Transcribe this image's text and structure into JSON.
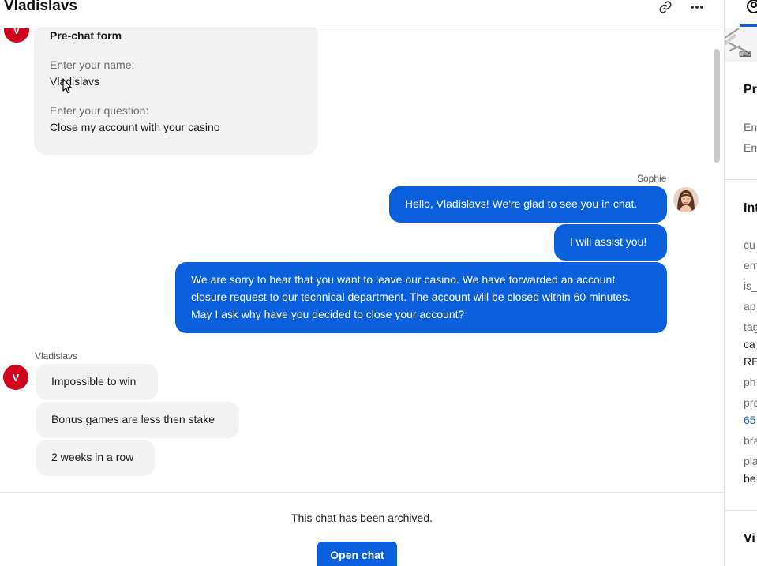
{
  "header": {
    "title": "Vladislavs"
  },
  "prechat": {
    "avatar_letter": "V",
    "title": "Pre-chat form",
    "fields": [
      {
        "label": "Enter your name:",
        "value": "Vladislavs"
      },
      {
        "label": "Enter your question:",
        "value": "Close my account with your casino"
      }
    ]
  },
  "agent": {
    "name": "Sophie",
    "messages": [
      "Hello, Vladislavs! We're glad to see you in chat.",
      "I will assist you!",
      "We are sorry to hear that you want to leave our casino. We have forwarded an account closure request to our technical department. The account will be closed within 60 minutes. May I ask why have you decided to close your account?"
    ]
  },
  "customer": {
    "name": "Vladislavs",
    "avatar_letter": "V",
    "messages": [
      "Impossible to win",
      "Bonus games are less then stake",
      "2 weeks in a row"
    ]
  },
  "footer": {
    "archived_text": "This chat has been archived.",
    "open_chat_label": "Open chat"
  },
  "right_panel": {
    "sections": [
      "Pr",
      "Int",
      "Vi"
    ],
    "prechat_rows": [
      "En",
      "En"
    ],
    "info_rows": [
      {
        "label": "cu"
      },
      {
        "label": "em"
      },
      {
        "label": "is_"
      },
      {
        "label": "ap"
      },
      {
        "label": "tag",
        "values": [
          "ca",
          "RE"
        ]
      },
      {
        "label": "ph"
      },
      {
        "label": "pro",
        "link": "65"
      },
      {
        "label": "bra"
      },
      {
        "label": "pla",
        "values": [
          "be"
        ]
      }
    ]
  },
  "colors": {
    "accent": "#0a5fdc",
    "customer_avatar": "#d0021b",
    "bubble_customer": "#f2f2f2"
  }
}
